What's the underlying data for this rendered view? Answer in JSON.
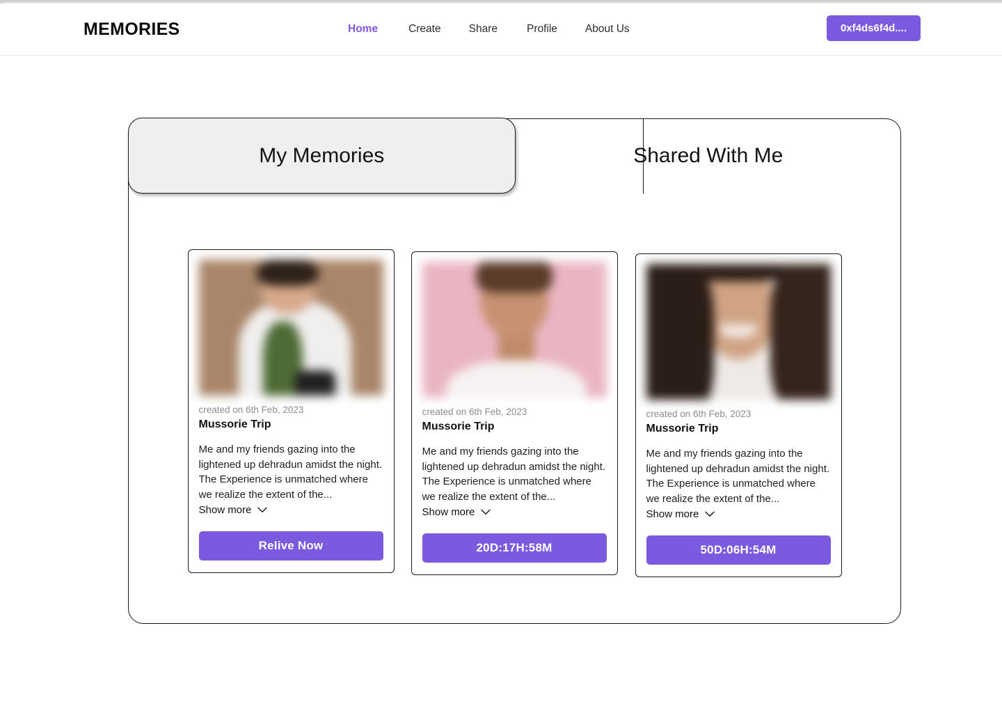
{
  "header": {
    "brand": "MEMORIES",
    "nav": [
      {
        "label": "Home",
        "active": true
      },
      {
        "label": "Create",
        "active": false
      },
      {
        "label": "Share",
        "active": false
      },
      {
        "label": "Profile",
        "active": false
      },
      {
        "label": "About Us",
        "active": false
      }
    ],
    "wallet_label": "0xf4ds6f4d...."
  },
  "tabs": [
    {
      "label": "My Memories",
      "active": true
    },
    {
      "label": "Shared With Me",
      "active": false
    }
  ],
  "cards": [
    {
      "date": "created on 6th Feb, 2023",
      "title": "Mussorie Trip",
      "description": "Me and my  friends gazing into the lightened up dehradun amidst the night.  The Experience is unmatched where we realize the extent of the...",
      "show_more": "Show more",
      "cta": "Relive Now"
    },
    {
      "date": "created on 6th Feb, 2023",
      "title": "Mussorie Trip",
      "description": "Me and my  friends gazing into the lightened up dehradun amidst the night.  The Experience is unmatched where we realize the extent of the...",
      "show_more": "Show more",
      "cta": "20D:17H:58M"
    },
    {
      "date": "created on 6th Feb, 2023",
      "title": "Mussorie Trip",
      "description": "Me and my  friends gazing into the lightened up dehradun amidst the night.  The Experience is unmatched where we realize the extent of the...",
      "show_more": "Show more",
      "cta": "50D:06H:54M"
    }
  ],
  "colors": {
    "accent": "#7b5ae0",
    "nav_active": "#8257e6",
    "tab_active_bg": "#efefef",
    "border": "#17171a",
    "muted_text": "#8c8c96"
  },
  "icons": {
    "chevron_down": "chevron-down-icon",
    "thumb_badge": "circle-badge-icon"
  }
}
